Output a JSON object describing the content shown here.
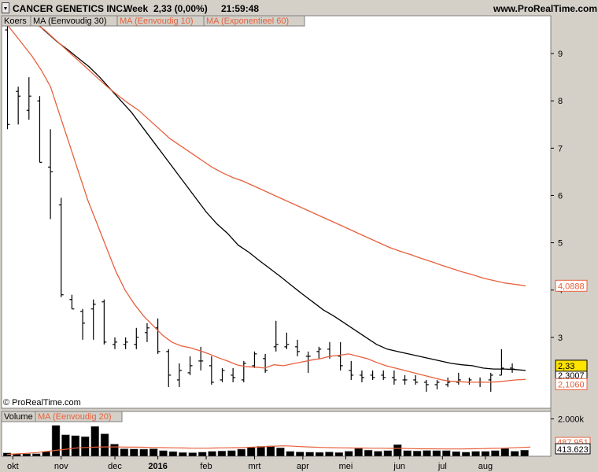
{
  "header": {
    "symbol": "CANCER GENETICS INC.",
    "period": "Week",
    "price_change": "2,33 (0,00%)",
    "time": "21:59:48",
    "site": "www.ProRealTime.com"
  },
  "watermark": "© ProRealTime.com",
  "price_panel": {
    "tabs": [
      {
        "label": "Koers",
        "color": "#000000"
      },
      {
        "label": "MA (Eenvoudig 30)",
        "color": "#000000"
      },
      {
        "label": "MA (Eenvoudig 10)",
        "color": "#e8603c"
      },
      {
        "label": "MA (Exponentieel 60)",
        "color": "#e8603c"
      }
    ],
    "price_tag": "2,33",
    "ma30_tag": "2,3007",
    "ma10_tag": "2,1060",
    "ema60_tag": "4,0888"
  },
  "volume_panel": {
    "tabs": [
      {
        "label": "Volume",
        "color": "#000000"
      },
      {
        "label": "MA (Eenvoudig 20)",
        "color": "#e8603c"
      }
    ],
    "tick_label": "2.000k",
    "ma_tag": "487.951",
    "volume_tag": "413.623"
  },
  "chart_data": {
    "type": "bar",
    "ylim": [
      1.5,
      9.8
    ],
    "yticks": [
      3,
      4,
      5,
      6,
      7,
      8,
      9
    ],
    "xticks": [
      {
        "label": "okt",
        "index": 0.5
      },
      {
        "label": "nov",
        "index": 5
      },
      {
        "label": "dec",
        "index": 10
      },
      {
        "label": "2016",
        "index": 14,
        "bold": true
      },
      {
        "label": "feb",
        "index": 18.5
      },
      {
        "label": "mrt",
        "index": 23
      },
      {
        "label": "apr",
        "index": 27.5
      },
      {
        "label": "mei",
        "index": 31.5
      },
      {
        "label": "jun",
        "index": 36.5
      },
      {
        "label": "jul",
        "index": 40.5
      },
      {
        "label": "aug",
        "index": 44.5
      }
    ],
    "series": [
      {
        "name": "Koers",
        "type": "ohlc",
        "color": "#000000",
        "values": [
          [
            9.5,
            9.6,
            7.4,
            7.5
          ],
          [
            8.2,
            8.3,
            7.5,
            8.1
          ],
          [
            7.8,
            8.5,
            7.6,
            8.1
          ],
          [
            8.0,
            8.1,
            6.7,
            6.7
          ],
          [
            6.6,
            7.4,
            5.5,
            6.5
          ],
          [
            5.8,
            5.95,
            3.85,
            3.9
          ],
          [
            3.8,
            3.9,
            3.6,
            3.6
          ],
          [
            3.55,
            3.6,
            2.95,
            3.3
          ],
          [
            3.6,
            3.8,
            2.95,
            3.7
          ],
          [
            3.75,
            3.8,
            2.85,
            2.9
          ],
          [
            2.85,
            3.0,
            2.75,
            2.9
          ],
          [
            2.85,
            3.0,
            2.75,
            2.9
          ],
          [
            2.85,
            3.2,
            2.75,
            3.0
          ],
          [
            3.1,
            3.3,
            2.9,
            3.2
          ],
          [
            3.2,
            3.4,
            2.65,
            2.7
          ],
          [
            2.7,
            2.75,
            1.95,
            2.2
          ],
          [
            2.1,
            2.45,
            1.95,
            2.3
          ],
          [
            2.25,
            2.6,
            2.2,
            2.4
          ],
          [
            2.5,
            2.8,
            2.3,
            2.5
          ],
          [
            2.4,
            2.6,
            2.0,
            2.05
          ],
          [
            2.1,
            2.35,
            2.05,
            2.3
          ],
          [
            2.2,
            2.35,
            2.05,
            2.15
          ],
          [
            2.1,
            2.5,
            2.05,
            2.45
          ],
          [
            2.4,
            2.7,
            2.35,
            2.65
          ],
          [
            2.55,
            2.65,
            2.25,
            2.3
          ],
          [
            2.8,
            3.35,
            2.7,
            2.85
          ],
          [
            2.8,
            3.1,
            2.75,
            2.85
          ],
          [
            2.8,
            2.95,
            2.6,
            2.7
          ],
          [
            2.6,
            2.7,
            2.25,
            2.6
          ],
          [
            2.7,
            2.8,
            2.55,
            2.75
          ],
          [
            2.75,
            2.9,
            2.55,
            2.6
          ],
          [
            2.6,
            2.9,
            2.3,
            2.4
          ],
          [
            2.3,
            2.5,
            2.1,
            2.2
          ],
          [
            2.2,
            2.3,
            2.05,
            2.15
          ],
          [
            2.2,
            2.3,
            2.1,
            2.15
          ],
          [
            2.2,
            2.3,
            2.1,
            2.15
          ],
          [
            2.15,
            2.3,
            2.0,
            2.1
          ],
          [
            2.1,
            2.2,
            2.0,
            2.1
          ],
          [
            2.1,
            2.2,
            2.0,
            2.05
          ],
          [
            2.05,
            2.1,
            1.85,
            2.0
          ],
          [
            2.0,
            2.1,
            1.9,
            2.05
          ],
          [
            2.0,
            2.15,
            1.95,
            2.05
          ],
          [
            2.05,
            2.25,
            2.0,
            2.1
          ],
          [
            2.05,
            2.15,
            2.0,
            2.1
          ],
          [
            2.05,
            2.15,
            1.95,
            2.05
          ],
          [
            2.1,
            2.25,
            1.85,
            2.2
          ],
          [
            2.2,
            2.75,
            2.2,
            2.35
          ],
          [
            2.35,
            2.45,
            2.25,
            2.33
          ]
        ]
      },
      {
        "name": "MA (Eenvoudig 30)",
        "type": "line",
        "color": "#000000",
        "start": 0,
        "values": [
          10.25,
          10.05,
          9.85,
          9.65,
          9.45,
          9.25,
          9.08,
          8.9,
          8.72,
          8.5,
          8.25,
          8.0,
          7.75,
          7.45,
          7.15,
          6.85,
          6.55,
          6.25,
          5.95,
          5.65,
          5.4,
          5.2,
          4.95,
          4.8,
          4.62,
          4.45,
          4.28,
          4.1,
          3.92,
          3.75,
          3.58,
          3.45,
          3.3,
          3.15,
          3.0,
          2.85,
          2.75,
          2.7,
          2.65,
          2.6,
          2.55,
          2.5,
          2.45,
          2.42,
          2.4,
          2.35,
          2.33,
          2.33,
          2.32,
          2.3
        ]
      },
      {
        "name": "MA (Eenvoudig 10)",
        "type": "line",
        "color": "#e8603c",
        "start": 0,
        "values": [
          9.7,
          9.45,
          9.2,
          8.95,
          8.65,
          8.3,
          7.7,
          7.1,
          6.5,
          5.9,
          5.4,
          4.9,
          4.4,
          4.0,
          3.7,
          3.45,
          3.25,
          3.05,
          2.9,
          2.82,
          2.78,
          2.72,
          2.65,
          2.57,
          2.5,
          2.42,
          2.38,
          2.37,
          2.35,
          2.42,
          2.4,
          2.44,
          2.48,
          2.52,
          2.55,
          2.6,
          2.62,
          2.65,
          2.6,
          2.55,
          2.47,
          2.4,
          2.35,
          2.3,
          2.25,
          2.2,
          2.15,
          2.1,
          2.07,
          2.06,
          2.05,
          2.05,
          2.05,
          2.06,
          2.08,
          2.1,
          2.11
        ]
      },
      {
        "name": "MA (Exponentieel 60)",
        "type": "line",
        "color": "#e8603c",
        "start": 0,
        "values": [
          9.8,
          9.65,
          9.5,
          9.3,
          9.1,
          8.9,
          8.7,
          8.5,
          8.3,
          8.12,
          7.95,
          7.8,
          7.6,
          7.4,
          7.2,
          7.05,
          6.9,
          6.75,
          6.6,
          6.48,
          6.38,
          6.3,
          6.2,
          6.1,
          6.0,
          5.9,
          5.8,
          5.7,
          5.6,
          5.5,
          5.4,
          5.3,
          5.2,
          5.1,
          5.0,
          4.9,
          4.82,
          4.75,
          4.67,
          4.6,
          4.52,
          4.45,
          4.38,
          4.32,
          4.25,
          4.2,
          4.15,
          4.12,
          4.09
        ]
      }
    ],
    "volume": {
      "ylim": [
        0,
        2400
      ],
      "yticks": [
        2000
      ],
      "values": [
        180,
        120,
        130,
        140,
        250,
        1650,
        1150,
        1100,
        1050,
        1600,
        1200,
        650,
        400,
        390,
        380,
        400,
        300,
        250,
        200,
        190,
        220,
        260,
        280,
        300,
        380,
        480,
        530,
        550,
        450,
        260,
        230,
        220,
        210,
        230,
        200,
        270,
        420,
        330,
        270,
        300,
        620,
        300,
        280,
        310,
        300,
        300,
        250,
        220,
        260,
        260,
        300,
        410,
        270,
        330
      ],
      "ma_values": [
        100,
        130,
        160,
        200,
        260,
        320,
        380,
        440,
        470,
        490,
        500,
        500,
        490,
        490,
        480,
        470,
        460,
        450,
        440,
        430,
        430,
        440,
        450,
        460,
        470,
        490,
        510,
        540,
        560,
        540,
        510,
        490,
        470,
        460,
        450,
        440,
        440,
        430,
        430,
        420,
        420,
        410,
        400,
        400,
        390,
        390,
        390,
        400,
        410,
        420,
        430,
        450,
        470,
        490
      ]
    }
  }
}
